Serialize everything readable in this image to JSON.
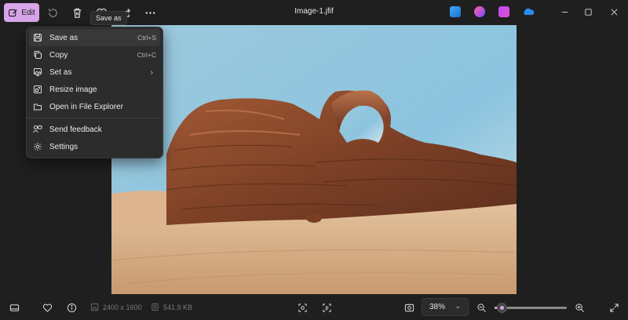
{
  "titlebar": {
    "edit_label": "Edit",
    "title": "Image-1.jfif"
  },
  "tooltip": {
    "text": "Save as"
  },
  "context_menu": {
    "items": [
      {
        "label": "Save as",
        "shortcut": "Ctrl+S",
        "icon": "save-icon",
        "active": true
      },
      {
        "label": "Copy",
        "shortcut": "Ctrl+C",
        "icon": "copy-icon"
      },
      {
        "label": "Set as",
        "shortcut": "",
        "icon": "set-as-icon",
        "submenu_glyph": "›"
      },
      {
        "label": "Resize image",
        "shortcut": "",
        "icon": "resize-icon"
      },
      {
        "label": "Open in File Explorer",
        "shortcut": "",
        "icon": "folder-icon"
      },
      {
        "label": "Send feedback",
        "shortcut": "",
        "icon": "feedback-icon"
      },
      {
        "label": "Settings",
        "shortcut": "",
        "icon": "gear-icon"
      }
    ]
  },
  "image": {
    "description_colors": {
      "sky": "#8fc3dc",
      "sand": "#dcb48a",
      "rock": "#8a4a2c"
    }
  },
  "status": {
    "dimensions": "2400 x 1600",
    "file_size": "541.9 KB",
    "zoom": "38%",
    "zoom_chevron": "⌄",
    "zoom_fraction": 0.1
  },
  "colors": {
    "accent": "#d9a5e9",
    "background": "#1f1f1f",
    "menu_bg": "#2c2c2c"
  }
}
